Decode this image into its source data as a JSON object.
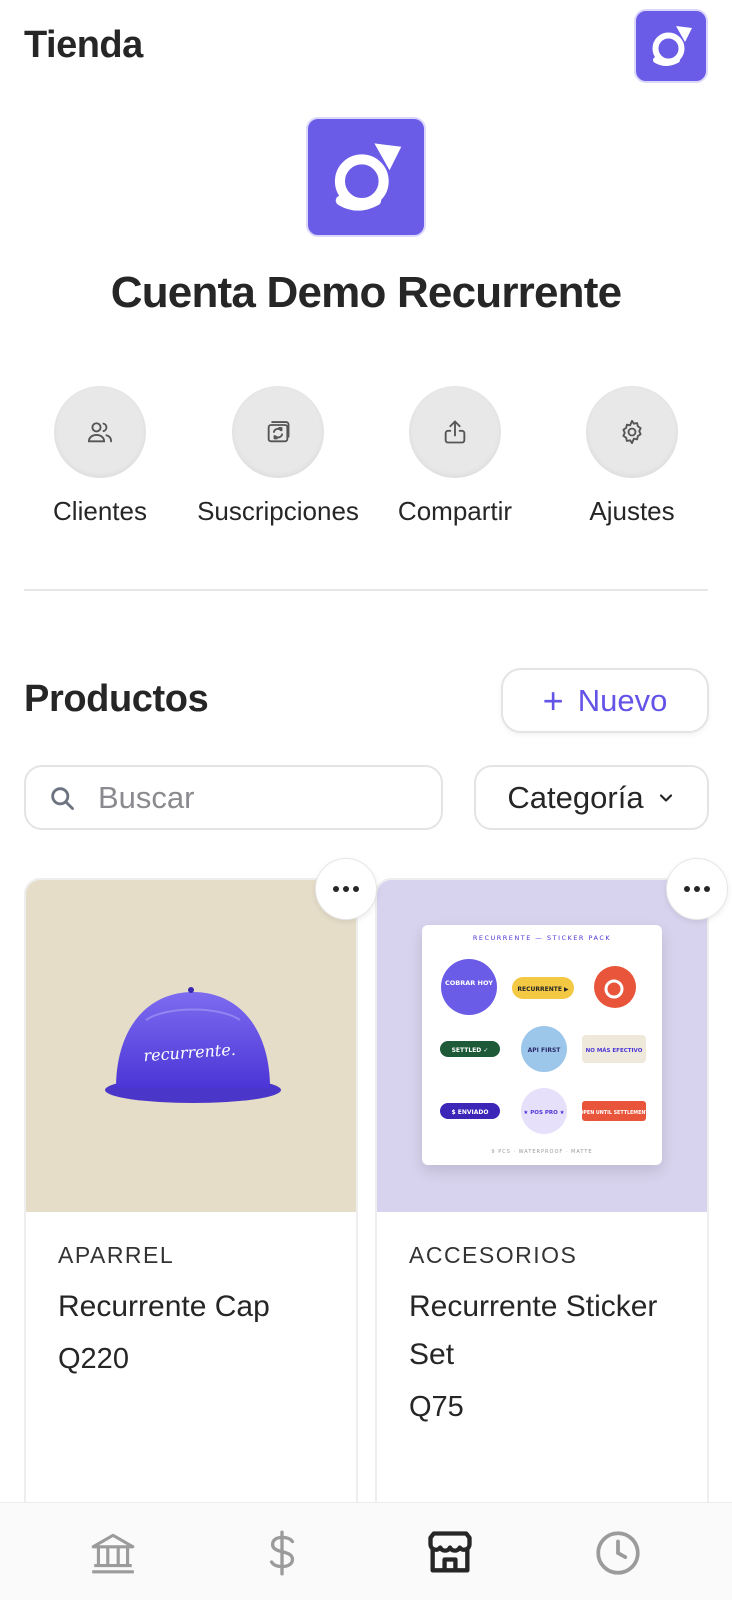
{
  "header": {
    "title": "Tienda",
    "avatar_icon": "brand-logo-icon"
  },
  "account": {
    "name": "Cuenta Demo Recurrente",
    "logo_icon": "brand-logo-icon"
  },
  "actions": [
    {
      "label": "Clientes",
      "icon": "users-icon"
    },
    {
      "label": "Suscripciones",
      "icon": "subscriptions-icon"
    },
    {
      "label": "Compartir",
      "icon": "share-icon"
    },
    {
      "label": "Ajustes",
      "icon": "gear-icon"
    }
  ],
  "products": {
    "title": "Productos",
    "new_label": "Nuevo",
    "search_placeholder": "Buscar",
    "category_label": "Categoría",
    "items": [
      {
        "category": "APARREL",
        "name": "Recurrente Cap",
        "price": "Q220",
        "image_text": "recurrente."
      },
      {
        "category": "ACCESORIOS",
        "name": "Recurrente Sticker Set",
        "price": "Q75",
        "sheet_title": "RECURRENTE — STICKER PACK",
        "stickers": [
          "COBRAR HOY",
          "RECURRENTE ▶",
          "SETTLED ✓",
          "API FIRST",
          "NO MÁS EFECTIVO",
          "$ ENVIADO",
          "★ POS PRO ★",
          "OPEN UNTIL SETTLEMENT"
        ],
        "sheet_footer": "9 PCS · WATERPROOF · MATTE"
      }
    ]
  },
  "tabbar": [
    {
      "icon": "bank-icon",
      "active": false
    },
    {
      "icon": "dollar-icon",
      "active": false
    },
    {
      "icon": "store-icon",
      "active": true
    },
    {
      "icon": "clock-icon",
      "active": false
    }
  ],
  "colors": {
    "brand": "#6b5ce7",
    "accent_text": "#6353e6",
    "text": "#262626"
  }
}
